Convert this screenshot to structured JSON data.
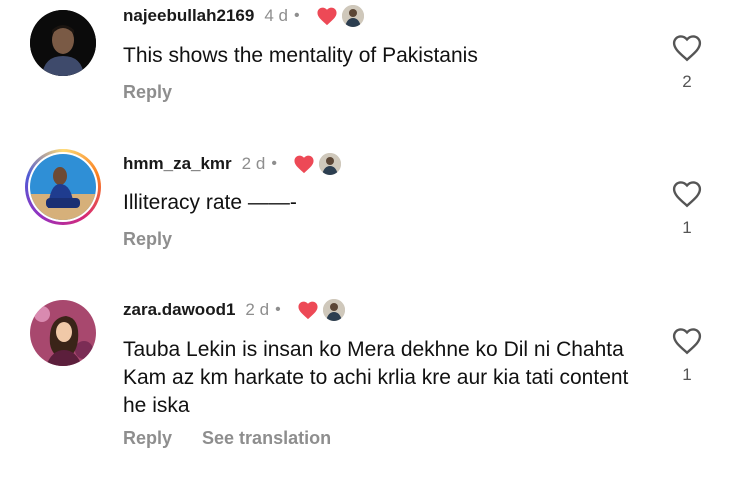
{
  "comments": [
    {
      "username": "najeebullah2169",
      "time": "4 d",
      "dot": "•",
      "text": "This shows the mentality of Pakistanis",
      "reply": "Reply",
      "likes": "2"
    },
    {
      "username": "hmm_za_kmr",
      "time": "2 d",
      "dot": "•",
      "text": "Illiteracy rate ——-",
      "reply": "Reply",
      "likes": "1"
    },
    {
      "username": "zara.dawood1",
      "time": "2 d",
      "dot": "•",
      "text": "Tauba Lekin is insan ko Mera dekhne ko Dil ni Chahta Kam az km harkate to achi krlia kre aur kia tati content he iska",
      "reply": "Reply",
      "translate": "See translation",
      "likes": "1"
    }
  ],
  "icons": {
    "creator_heart": "heart-filled-icon",
    "like": "heart-outline-icon"
  },
  "colors": {
    "heart_red": "#ed4956",
    "muted": "#8e8e8e"
  }
}
